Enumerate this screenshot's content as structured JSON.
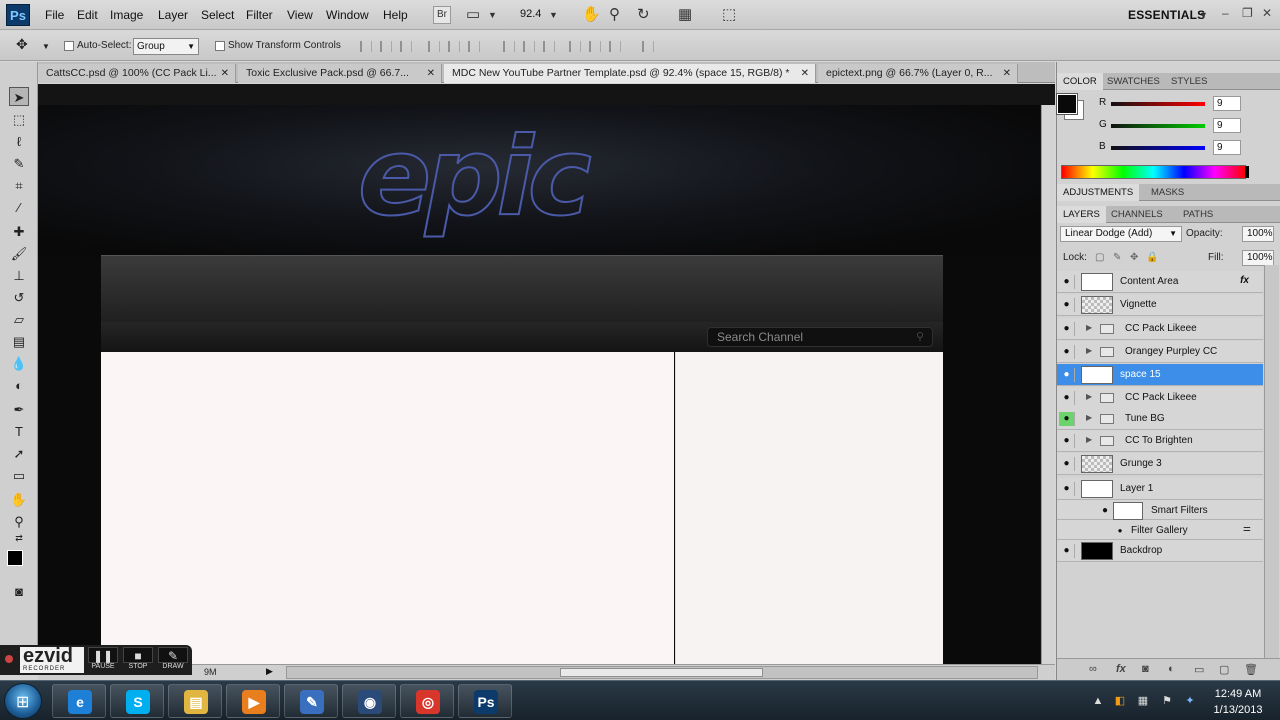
{
  "menubar": {
    "logo": "Ps",
    "items": [
      "File",
      "Edit",
      "Image",
      "Layer",
      "Select",
      "Filter",
      "View",
      "Window",
      "Help"
    ],
    "br_label": "Br",
    "zoom": "92.4",
    "workspace": "ESSENTIALS"
  },
  "options": {
    "auto_select_label": "Auto-Select:",
    "auto_select_value": "Group",
    "show_transform_label": "Show Transform Controls"
  },
  "tabs": [
    {
      "label": "CattsCC.psd @ 100% (CC Pack Li..."
    },
    {
      "label": "Toxic Exclusive Pack.psd @ 66.7..."
    },
    {
      "label": "MDC New YouTube Partner Template.psd @ 92.4% (space 15, RGB/8) *"
    },
    {
      "label": "epictext.png @ 66.7% (Layer 0, R..."
    }
  ],
  "canvas": {
    "banner_text": "epic",
    "search_placeholder": "Search Channel"
  },
  "status": {
    "doc_size": "9M"
  },
  "ezvid": {
    "logo": "ezvid",
    "sub": "RECORDER",
    "pause": "PAUSE",
    "stop": "STOP",
    "draw": "DRAW"
  },
  "color_panel": {
    "tabs": [
      "COLOR",
      "SWATCHES",
      "STYLES"
    ],
    "channels": [
      {
        "label": "R",
        "value": "9",
        "color": "#ff0000"
      },
      {
        "label": "G",
        "value": "9",
        "color": "#00cc00"
      },
      {
        "label": "B",
        "value": "9",
        "color": "#0000ff"
      }
    ],
    "foreground": "#090909",
    "background": "#ffffff"
  },
  "adjust_panel": {
    "tabs": [
      "ADJUSTMENTS",
      "MASKS"
    ]
  },
  "layers_panel": {
    "tabs": [
      "LAYERS",
      "CHANNELS",
      "PATHS"
    ],
    "blend_mode": "Linear Dodge (Add)",
    "opacity_label": "Opacity:",
    "opacity": "100%",
    "lock_label": "Lock:",
    "fill_label": "Fill:",
    "fill": "100%",
    "layers": [
      {
        "name": "Content Area",
        "kind": "layer",
        "thumb": "white",
        "fx": "fx"
      },
      {
        "name": "Vignette",
        "kind": "layer",
        "thumb": "checker"
      },
      {
        "name": "CC Pack Likeee",
        "kind": "group"
      },
      {
        "name": "Orangey Purpley CC",
        "kind": "group"
      },
      {
        "name": "space 15",
        "kind": "layer",
        "thumb": "white",
        "selected": true
      },
      {
        "name": "CC Pack Likeee",
        "kind": "group"
      },
      {
        "name": "Tune BG",
        "kind": "group",
        "green_eye": true
      },
      {
        "name": "CC To Brighten",
        "kind": "group"
      },
      {
        "name": "Grunge 3",
        "kind": "layer",
        "thumb": "checker"
      },
      {
        "name": "Layer 1",
        "kind": "layer",
        "thumb": "white"
      },
      {
        "name": "Smart Filters",
        "kind": "smart"
      },
      {
        "name": "Filter Gallery",
        "kind": "filter"
      },
      {
        "name": "Backdrop",
        "kind": "layer",
        "thumb": "black"
      }
    ]
  },
  "taskbar": {
    "time": "12:49 AM",
    "date": "1/13/2013",
    "apps": [
      {
        "name": "internet-explorer",
        "glyph": "e",
        "color": "#1d7fd6"
      },
      {
        "name": "skype",
        "glyph": "S",
        "color": "#00aff0"
      },
      {
        "name": "file-explorer",
        "glyph": "▤",
        "color": "#e0b640"
      },
      {
        "name": "media-player",
        "glyph": "▶",
        "color": "#e87e1e"
      },
      {
        "name": "editor",
        "glyph": "✎",
        "color": "#3a6fc0"
      },
      {
        "name": "cinema4d",
        "glyph": "◉",
        "color": "#2a4a7a"
      },
      {
        "name": "chrome",
        "glyph": "◎",
        "color": "#d9362b"
      },
      {
        "name": "photoshop",
        "glyph": "Ps",
        "color": "#0b3a6b"
      }
    ]
  }
}
